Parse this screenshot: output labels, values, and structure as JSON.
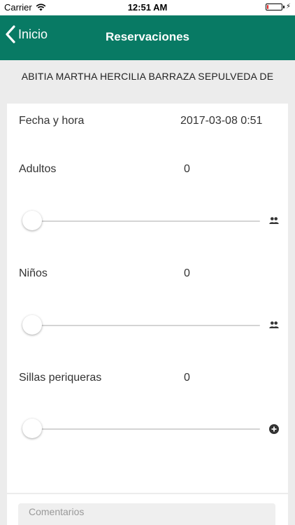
{
  "status_bar": {
    "carrier": "Carrier",
    "time": "12:51 AM",
    "battery_level": 0.1,
    "battery_color": "#e02020"
  },
  "nav": {
    "back_label": "Inicio",
    "title": "Reservaciones",
    "background_color": "#087a64"
  },
  "customer_name": "ABITIA MARTHA HERCILIA BARRAZA SEPULVEDA DE",
  "form": {
    "datetime": {
      "label": "Fecha y hora",
      "value": "2017-03-08 0:51"
    },
    "adults": {
      "label": "Adultos",
      "value": "0",
      "slider_fraction": 0,
      "icon": "people-icon"
    },
    "children": {
      "label": "Niños",
      "value": "0",
      "slider_fraction": 0,
      "icon": "people-icon"
    },
    "high_chairs": {
      "label": "Sillas periqueras",
      "value": "0",
      "slider_fraction": 0,
      "icon": "plus-circle-icon"
    },
    "comments": {
      "placeholder": "Comentarios",
      "value": ""
    }
  }
}
